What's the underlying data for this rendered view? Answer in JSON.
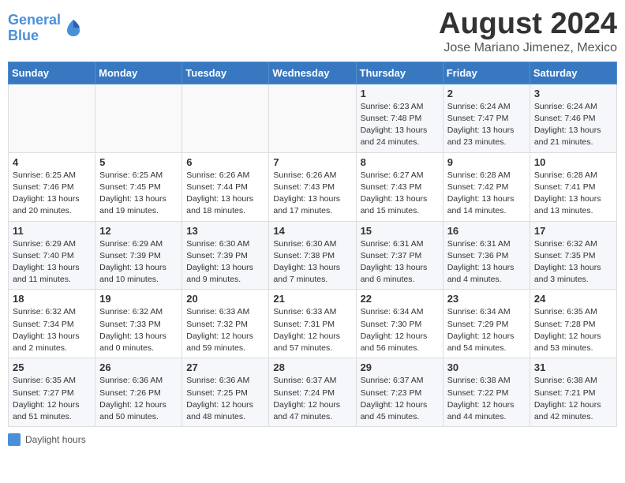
{
  "header": {
    "logo_line1": "General",
    "logo_line2": "Blue",
    "title": "August 2024",
    "subtitle": "Jose Mariano Jimenez, Mexico"
  },
  "calendar": {
    "days_of_week": [
      "Sunday",
      "Monday",
      "Tuesday",
      "Wednesday",
      "Thursday",
      "Friday",
      "Saturday"
    ],
    "weeks": [
      [
        {
          "day": "",
          "info": ""
        },
        {
          "day": "",
          "info": ""
        },
        {
          "day": "",
          "info": ""
        },
        {
          "day": "",
          "info": ""
        },
        {
          "day": "1",
          "info": "Sunrise: 6:23 AM\nSunset: 7:48 PM\nDaylight: 13 hours and 24 minutes."
        },
        {
          "day": "2",
          "info": "Sunrise: 6:24 AM\nSunset: 7:47 PM\nDaylight: 13 hours and 23 minutes."
        },
        {
          "day": "3",
          "info": "Sunrise: 6:24 AM\nSunset: 7:46 PM\nDaylight: 13 hours and 21 minutes."
        }
      ],
      [
        {
          "day": "4",
          "info": "Sunrise: 6:25 AM\nSunset: 7:46 PM\nDaylight: 13 hours and 20 minutes."
        },
        {
          "day": "5",
          "info": "Sunrise: 6:25 AM\nSunset: 7:45 PM\nDaylight: 13 hours and 19 minutes."
        },
        {
          "day": "6",
          "info": "Sunrise: 6:26 AM\nSunset: 7:44 PM\nDaylight: 13 hours and 18 minutes."
        },
        {
          "day": "7",
          "info": "Sunrise: 6:26 AM\nSunset: 7:43 PM\nDaylight: 13 hours and 17 minutes."
        },
        {
          "day": "8",
          "info": "Sunrise: 6:27 AM\nSunset: 7:43 PM\nDaylight: 13 hours and 15 minutes."
        },
        {
          "day": "9",
          "info": "Sunrise: 6:28 AM\nSunset: 7:42 PM\nDaylight: 13 hours and 14 minutes."
        },
        {
          "day": "10",
          "info": "Sunrise: 6:28 AM\nSunset: 7:41 PM\nDaylight: 13 hours and 13 minutes."
        }
      ],
      [
        {
          "day": "11",
          "info": "Sunrise: 6:29 AM\nSunset: 7:40 PM\nDaylight: 13 hours and 11 minutes."
        },
        {
          "day": "12",
          "info": "Sunrise: 6:29 AM\nSunset: 7:39 PM\nDaylight: 13 hours and 10 minutes."
        },
        {
          "day": "13",
          "info": "Sunrise: 6:30 AM\nSunset: 7:39 PM\nDaylight: 13 hours and 9 minutes."
        },
        {
          "day": "14",
          "info": "Sunrise: 6:30 AM\nSunset: 7:38 PM\nDaylight: 13 hours and 7 minutes."
        },
        {
          "day": "15",
          "info": "Sunrise: 6:31 AM\nSunset: 7:37 PM\nDaylight: 13 hours and 6 minutes."
        },
        {
          "day": "16",
          "info": "Sunrise: 6:31 AM\nSunset: 7:36 PM\nDaylight: 13 hours and 4 minutes."
        },
        {
          "day": "17",
          "info": "Sunrise: 6:32 AM\nSunset: 7:35 PM\nDaylight: 13 hours and 3 minutes."
        }
      ],
      [
        {
          "day": "18",
          "info": "Sunrise: 6:32 AM\nSunset: 7:34 PM\nDaylight: 13 hours and 2 minutes."
        },
        {
          "day": "19",
          "info": "Sunrise: 6:32 AM\nSunset: 7:33 PM\nDaylight: 13 hours and 0 minutes."
        },
        {
          "day": "20",
          "info": "Sunrise: 6:33 AM\nSunset: 7:32 PM\nDaylight: 12 hours and 59 minutes."
        },
        {
          "day": "21",
          "info": "Sunrise: 6:33 AM\nSunset: 7:31 PM\nDaylight: 12 hours and 57 minutes."
        },
        {
          "day": "22",
          "info": "Sunrise: 6:34 AM\nSunset: 7:30 PM\nDaylight: 12 hours and 56 minutes."
        },
        {
          "day": "23",
          "info": "Sunrise: 6:34 AM\nSunset: 7:29 PM\nDaylight: 12 hours and 54 minutes."
        },
        {
          "day": "24",
          "info": "Sunrise: 6:35 AM\nSunset: 7:28 PM\nDaylight: 12 hours and 53 minutes."
        }
      ],
      [
        {
          "day": "25",
          "info": "Sunrise: 6:35 AM\nSunset: 7:27 PM\nDaylight: 12 hours and 51 minutes."
        },
        {
          "day": "26",
          "info": "Sunrise: 6:36 AM\nSunset: 7:26 PM\nDaylight: 12 hours and 50 minutes."
        },
        {
          "day": "27",
          "info": "Sunrise: 6:36 AM\nSunset: 7:25 PM\nDaylight: 12 hours and 48 minutes."
        },
        {
          "day": "28",
          "info": "Sunrise: 6:37 AM\nSunset: 7:24 PM\nDaylight: 12 hours and 47 minutes."
        },
        {
          "day": "29",
          "info": "Sunrise: 6:37 AM\nSunset: 7:23 PM\nDaylight: 12 hours and 45 minutes."
        },
        {
          "day": "30",
          "info": "Sunrise: 6:38 AM\nSunset: 7:22 PM\nDaylight: 12 hours and 44 minutes."
        },
        {
          "day": "31",
          "info": "Sunrise: 6:38 AM\nSunset: 7:21 PM\nDaylight: 12 hours and 42 minutes."
        }
      ]
    ]
  },
  "legend": {
    "label": "Daylight hours"
  }
}
